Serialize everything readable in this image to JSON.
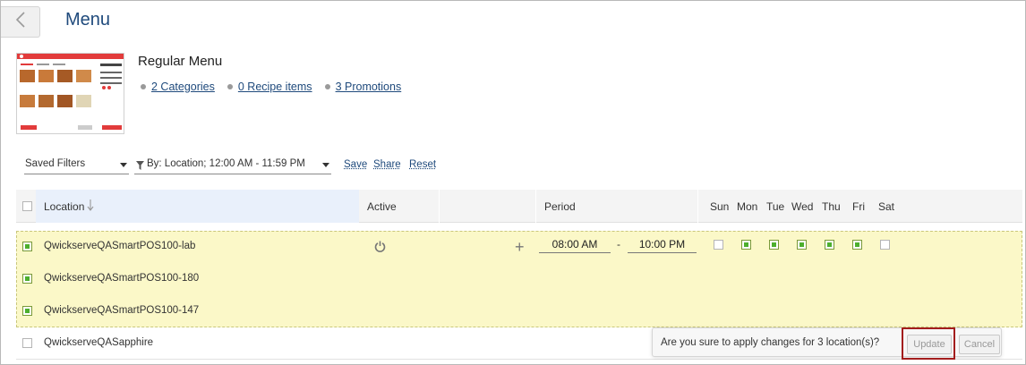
{
  "header": {
    "title": "Menu"
  },
  "menu": {
    "name": "Regular Menu",
    "links": [
      "2 Categories",
      "0 Recipe items",
      "3 Promotions"
    ]
  },
  "filters": {
    "saved_filters": "Saved Filters",
    "by_filter": "By: Location; 12:00 AM - 11:59 PM",
    "save": "Save",
    "share": "Share",
    "reset": "Reset"
  },
  "grid": {
    "columns": {
      "location": "Location",
      "active": "Active",
      "period": "Period"
    },
    "days": [
      "Sun",
      "Mon",
      "Tue",
      "Wed",
      "Thu",
      "Fri",
      "Sat"
    ],
    "rows": [
      {
        "location": "QwickserveQASmartPOS100-lab",
        "selected": true,
        "start": "08:00 AM",
        "end": "10:00 PM",
        "days": [
          false,
          true,
          true,
          true,
          true,
          true,
          false
        ]
      },
      {
        "location": "QwickserveQASmartPOS100-180",
        "selected": true
      },
      {
        "location": "QwickserveQASmartPOS100-147",
        "selected": true
      },
      {
        "location": "QwickserveQASapphire",
        "selected": false
      }
    ]
  },
  "confirm": {
    "message": "Are you sure to apply changes for 3 location(s)?",
    "update": "Update",
    "cancel": "Cancel"
  },
  "colors": {
    "accent": "#1f4a7c",
    "selected_row": "#fbf8c8",
    "checked": "#4caf2e",
    "highlight": "#a31d1d"
  }
}
